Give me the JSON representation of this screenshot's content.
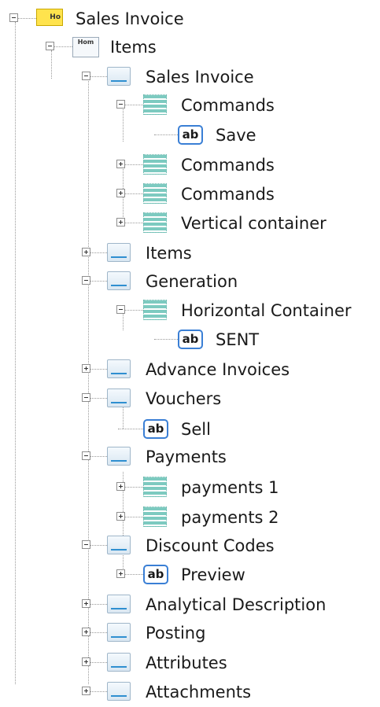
{
  "tree": {
    "root": {
      "label": "Sales Invoice",
      "icon": "root-form-icon",
      "badge": "Ho"
    },
    "items_node": {
      "label": "Items",
      "icon": "page-icon",
      "badge": "Hom"
    },
    "nodes": [
      {
        "label": "Sales Invoice",
        "icon": "form-icon",
        "expander": "minus"
      },
      {
        "label": "Commands",
        "icon": "container-icon",
        "expander": "minus"
      },
      {
        "label": "Save",
        "icon": "ab-field-icon",
        "expander": "none"
      },
      {
        "label": "Commands",
        "icon": "container-icon",
        "expander": "plus"
      },
      {
        "label": "Commands",
        "icon": "container-icon",
        "expander": "plus"
      },
      {
        "label": "Vertical container",
        "icon": "container-icon",
        "expander": "plus"
      },
      {
        "label": "Items",
        "icon": "form-icon",
        "expander": "plus"
      },
      {
        "label": "Generation",
        "icon": "form-icon",
        "expander": "minus"
      },
      {
        "label": "Horizontal Container",
        "icon": "container-icon",
        "expander": "minus"
      },
      {
        "label": "SENT",
        "icon": "ab-field-icon",
        "expander": "none"
      },
      {
        "label": "Advance Invoices",
        "icon": "form-icon",
        "expander": "plus"
      },
      {
        "label": "Vouchers",
        "icon": "form-icon",
        "expander": "minus"
      },
      {
        "label": "Sell",
        "icon": "ab-field-icon",
        "expander": "none"
      },
      {
        "label": "Payments",
        "icon": "form-icon",
        "expander": "minus"
      },
      {
        "label": "payments 1",
        "icon": "container-icon",
        "expander": "plus"
      },
      {
        "label": "payments 2",
        "icon": "container-icon",
        "expander": "plus"
      },
      {
        "label": "Discount Codes",
        "icon": "form-icon",
        "expander": "minus"
      },
      {
        "label": "Preview",
        "icon": "ab-field-icon",
        "expander": "plus"
      },
      {
        "label": "Analytical Description",
        "icon": "form-icon",
        "expander": "plus"
      },
      {
        "label": "Posting",
        "icon": "form-icon",
        "expander": "plus"
      },
      {
        "label": "Attributes",
        "icon": "form-icon",
        "expander": "plus"
      },
      {
        "label": "Attachments",
        "icon": "form-icon",
        "expander": "plus"
      }
    ],
    "ab_text": "ab",
    "colors": {
      "connector": "#9a9a9a",
      "container": "#7dcac0",
      "field_border": "#3a7fd5",
      "root": "#ffe34d"
    }
  }
}
